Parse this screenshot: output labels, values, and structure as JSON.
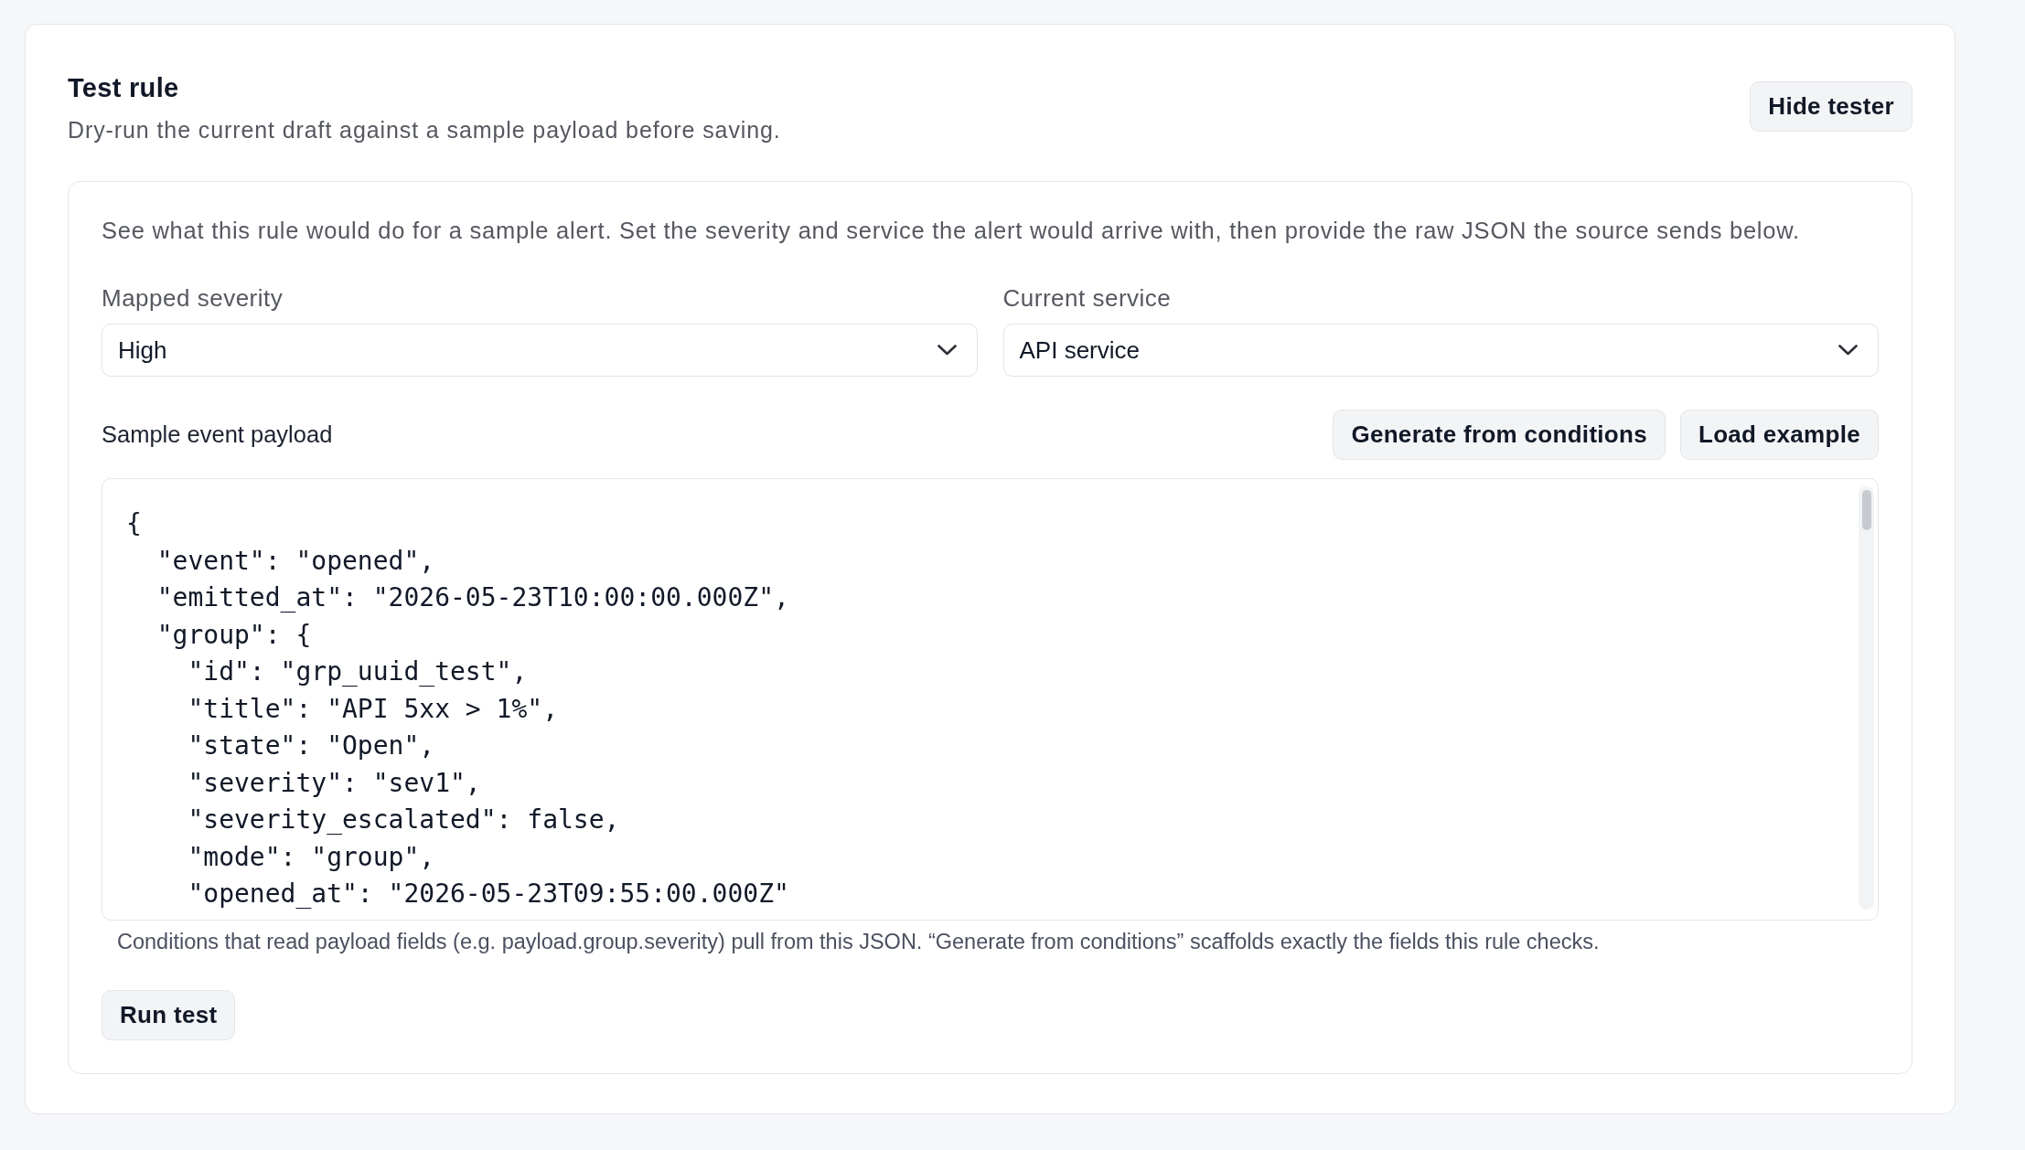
{
  "panel": {
    "title": "Test rule",
    "subtitle": "Dry-run the current draft against a sample payload before saving.",
    "toggle_button": "Hide tester"
  },
  "tester": {
    "description": "See what this rule would do for a sample alert. Set the severity and service the alert would arrive with, then provide the raw JSON the source sends below.",
    "fields": [
      {
        "label": "Mapped severity",
        "value": "High"
      },
      {
        "label": "Current service",
        "value": "API service"
      }
    ],
    "payload": {
      "label": "Sample event payload",
      "buttons": [
        "Generate from conditions",
        "Load example"
      ],
      "lines": [
        "{",
        "  \"event\": \"opened\",",
        "  \"emitted_at\": \"2026-05-23T10:00:00.000Z\",",
        "  \"group\": {",
        "    \"id\": \"grp_uuid_test\",",
        "    \"title\": \"API 5xx > 1%\",",
        "    \"state\": \"Open\",",
        "    \"severity\": \"sev1\",",
        "    \"severity_escalated\": false,",
        "    \"mode\": \"group\",",
        "    \"opened_at\": \"2026-05-23T09:55:00.000Z\""
      ]
    },
    "help_text": "Conditions that read payload fields (e.g. payload.group.severity) pull from this JSON. “Generate from conditions” scaffolds exactly the fields this rule checks.",
    "run_button": "Run test"
  }
}
